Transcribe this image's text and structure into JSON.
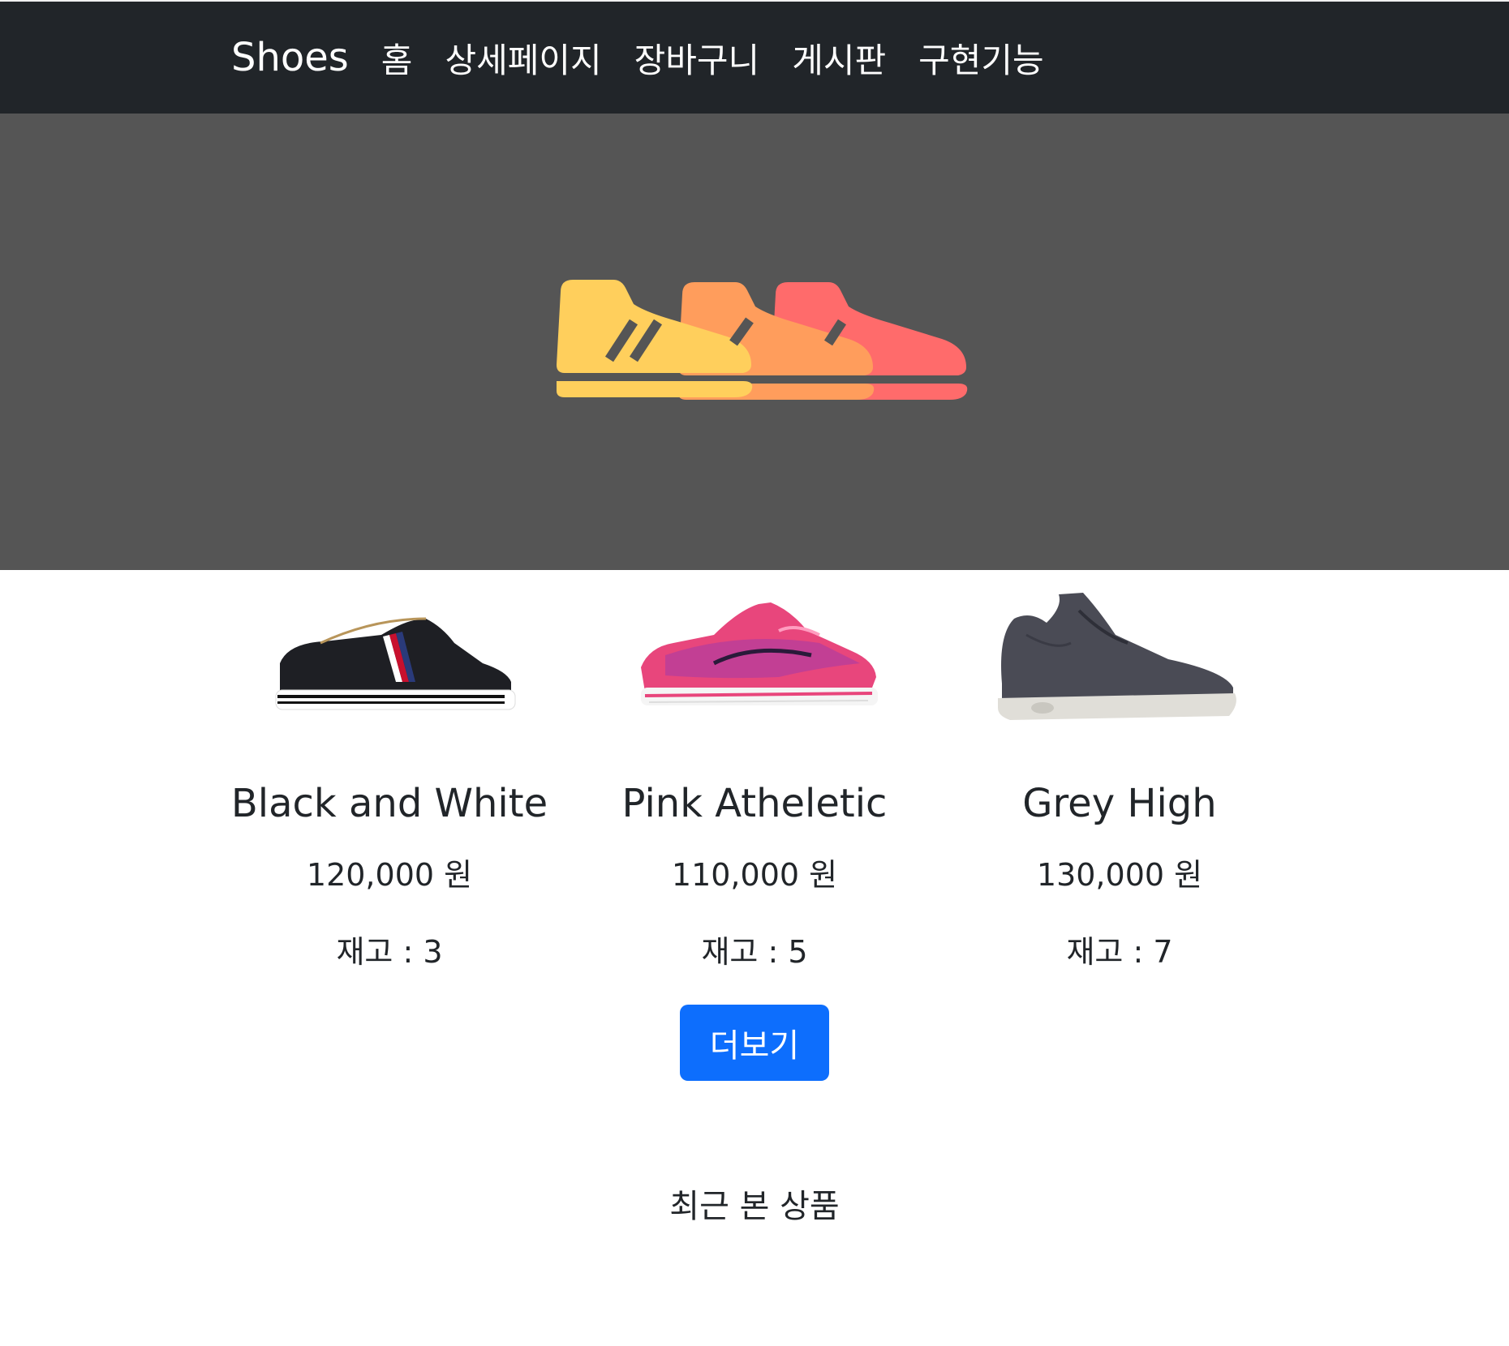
{
  "navbar": {
    "brand": "Shoes",
    "links": [
      {
        "label": "홈"
      },
      {
        "label": "상세페이지"
      },
      {
        "label": "장바구니"
      },
      {
        "label": "게시판"
      },
      {
        "label": "구현기능"
      }
    ],
    "background": "#212529"
  },
  "hero": {
    "background": "#555555",
    "icon": "three-sneakers-logo",
    "icon_colors": [
      "#ffcf5c",
      "#ff9d5c",
      "#ff6b6b"
    ]
  },
  "products": [
    {
      "name": "Black and White",
      "price": "120,000 원",
      "stock": "재고 : 3"
    },
    {
      "name": "Pink Atheletic",
      "price": "110,000 원",
      "stock": "재고 : 5"
    },
    {
      "name": "Grey High",
      "price": "130,000 원",
      "stock": "재고 : 7"
    }
  ],
  "more_button": {
    "label": "더보기",
    "color": "#0d6efd"
  },
  "recent": {
    "title": "최근 본 상품"
  }
}
